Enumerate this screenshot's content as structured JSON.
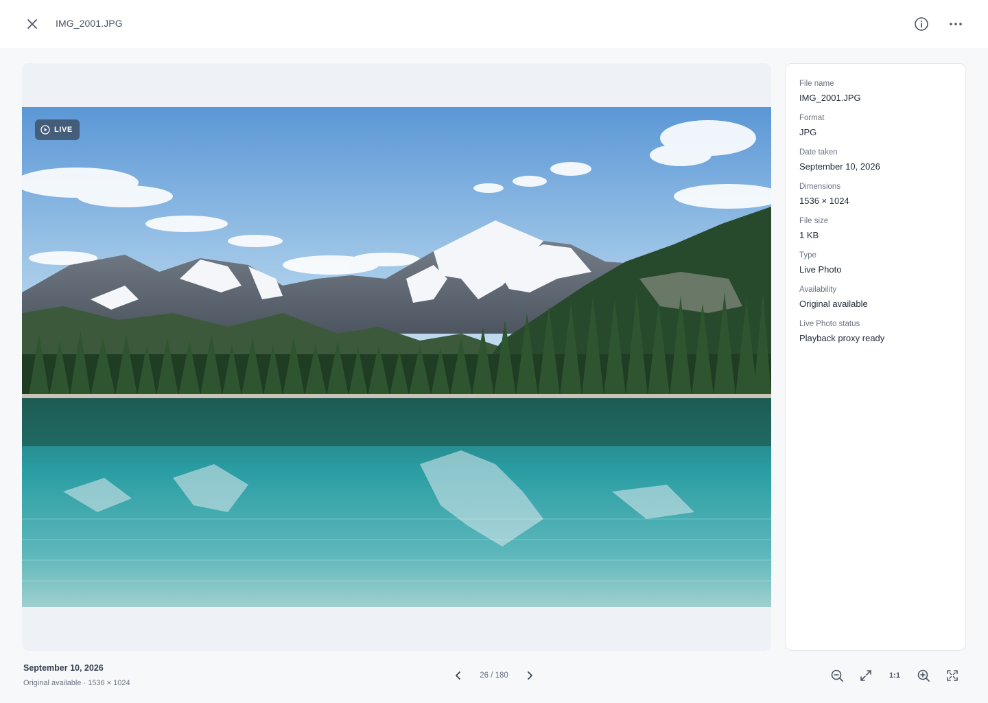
{
  "header": {
    "title": "IMG_2001.JPG",
    "close_icon": "close-icon",
    "info_icon": "info-icon",
    "more_icon": "more-horizontal-icon"
  },
  "viewer": {
    "live_badge": "LIVE",
    "live_icon": "play-circle-icon"
  },
  "info_panel": {
    "fields": [
      {
        "label": "File name",
        "value": "IMG_2001.JPG"
      },
      {
        "label": "Format",
        "value": "JPG"
      },
      {
        "label": "Date taken",
        "value": "September 10, 2026"
      },
      {
        "label": "Dimensions",
        "value": "1536 × 1024"
      },
      {
        "label": "File size",
        "value": "1 KB"
      },
      {
        "label": "Type",
        "value": "Live Photo"
      },
      {
        "label": "Availability",
        "value": "Original available"
      },
      {
        "label": "Live Photo status",
        "value": "Playback proxy ready"
      }
    ]
  },
  "footer": {
    "date": "September 10, 2026",
    "subtitle": "Original available · 1536 × 1024",
    "pager": {
      "count": "26 / 180",
      "prev_icon": "chevron-left-icon",
      "next_icon": "chevron-right-icon"
    },
    "tools": {
      "zoom_out_icon": "zoom-out-icon",
      "fit_icon": "expand-diagonal-icon",
      "actual_size_label": "1:1",
      "zoom_in_icon": "zoom-in-icon",
      "fullscreen_icon": "fullscreen-icon"
    }
  },
  "colors": {
    "accent": "#374151",
    "viewer_bg": "#eef1f5",
    "badge_bg": "#374455"
  }
}
